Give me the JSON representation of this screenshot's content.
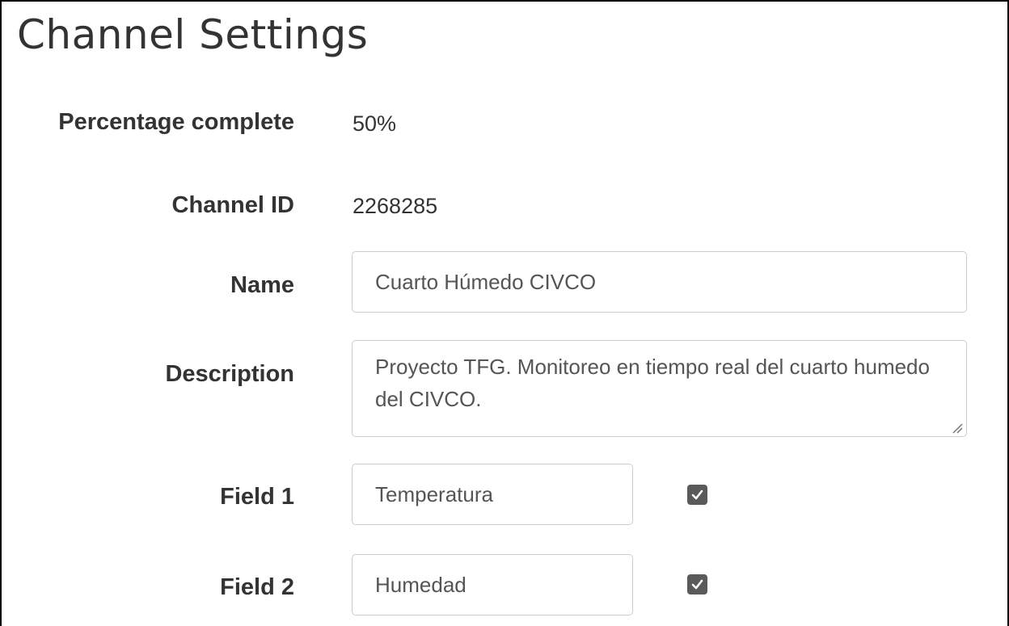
{
  "page": {
    "title": "Channel Settings"
  },
  "rows": {
    "percentage": {
      "label": "Percentage complete",
      "value": "50%"
    },
    "channel_id": {
      "label": "Channel ID",
      "value": "2268285"
    },
    "name": {
      "label": "Name",
      "value": "Cuarto Húmedo CIVCO"
    },
    "description": {
      "label": "Description",
      "value": "Proyecto TFG. Monitoreo en tiempo real del cuarto humedo del CIVCO."
    },
    "field1": {
      "label": "Field 1",
      "value": "Temperatura",
      "checked": true
    },
    "field2": {
      "label": "Field 2",
      "value": "Humedad",
      "checked": true
    }
  },
  "icons": {
    "checkbox": "check-icon",
    "resize": "resize-grip-icon"
  },
  "colors": {
    "text": "#333333",
    "input_text": "#555555",
    "input_border": "#cccccc",
    "checkbox_fill": "#5a5a5a"
  }
}
